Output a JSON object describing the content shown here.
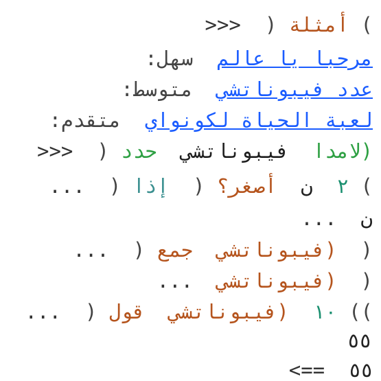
{
  "console": {
    "prompt": ">>>",
    "continuation": "...",
    "result_marker": "<==",
    "examples_header": {
      "open_paren": "(",
      "word": "أمثلة",
      "close_paren": ")"
    },
    "examples": [
      {
        "label": "سهل:",
        "link": "مرحبا يا عالم"
      },
      {
        "label": "متوسط:",
        "link": "عدد فيبوناتشي"
      },
      {
        "label": "متقدم:",
        "link": "لعبة الحياة لكونواي"
      }
    ],
    "code": {
      "line1_open": "(",
      "line1_define": "حدد",
      "line1_name": "فيبوناتشي",
      "line1_lambda": "(لامدا",
      "line2_open": "(",
      "line2_if": "إذا",
      "line2_cond_open": "(",
      "line2_less": "أصغر؟",
      "line2_n": "ن",
      "line2_two": "٢",
      "line2_close": ")",
      "line3_n": "ن",
      "line4_open": "(",
      "line4_add": "جمع",
      "line4_call": "(فيبوناتشي",
      "line4_rest": "(",
      "line5_call": "(فيبوناتشي",
      "line5_rest": "(",
      "line6_open": "(",
      "line6_say": "قول",
      "line6_call": "(فيبوناتشي",
      "line6_arg": "١٠",
      "line6_close": "))"
    },
    "output_value": "٥٥",
    "result_value": "٥٥"
  },
  "colors": {
    "link": "#1a5cff",
    "keyword_orange": "#b5541d",
    "keyword_green": "#2ea043",
    "number": "#1a8f6f"
  }
}
